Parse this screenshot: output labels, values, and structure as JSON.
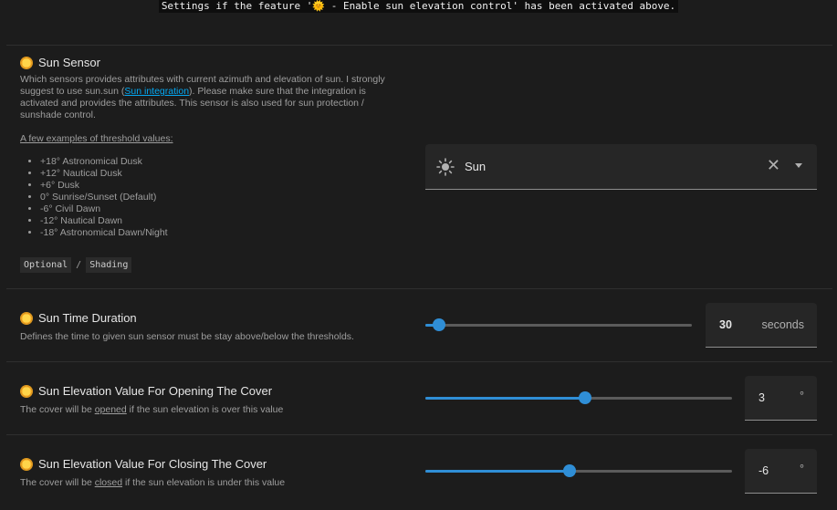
{
  "top_note": "Settings if the feature '🌞 - Enable sun elevation control' has been activated above.",
  "sensor": {
    "title": "Sun Sensor",
    "desc_part1": "Which sensors provides attributes with current azimuth and elevation of sun. I strongly suggest to use sun.sun (",
    "desc_link": "Sun integration",
    "desc_part2": "). Please make sure that the integration is activated and provides the attributes. This sensor is also used for sun protection / sunshade control.",
    "examples_heading": "A few examples of threshold values:",
    "examples": [
      "+18° Astronomical Dusk",
      "+12° Nautical Dusk",
      "+6° Dusk",
      "0° Sunrise/Sunset (Default)",
      "-6° Civil Dawn",
      "-12° Nautical Dawn",
      "-18° Astronomical Dawn/Night"
    ],
    "tags": [
      "Optional",
      "Shading"
    ],
    "tag_separator": "/",
    "select": {
      "value": "Sun",
      "icon": "sun-icon",
      "clear_icon": "close-icon",
      "caret_icon": "chevron-down-icon"
    }
  },
  "duration": {
    "title": "Sun Time Duration",
    "desc": "Defines the time to given sun sensor must be stay above/below the thresholds.",
    "value": "30",
    "unit": "seconds",
    "slider_fraction": 0.05
  },
  "opening": {
    "title": "Sun Elevation Value For Opening The Cover",
    "desc_a": "The cover will be ",
    "desc_u": "opened",
    "desc_b": " if the sun elevation is over this value",
    "value": "3",
    "unit": "°",
    "slider_fraction": 0.52
  },
  "closing": {
    "title": "Sun Elevation Value For Closing The Cover",
    "desc_a": "The cover will be ",
    "desc_u": "closed",
    "desc_b": " if the sun elevation is under this value",
    "value": "-6",
    "unit": "°",
    "slider_fraction": 0.47
  },
  "colors": {
    "accent": "#2f8ed6",
    "background": "#1c1c1c",
    "link": "#03a9f4",
    "emoji": "#f5a623"
  }
}
